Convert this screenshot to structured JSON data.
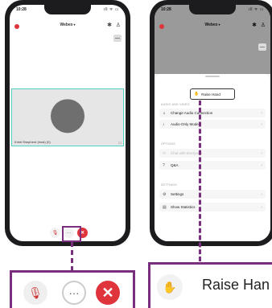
{
  "status": {
    "time": "10:28",
    "signal": "ıll ᯤ ▭"
  },
  "header": {
    "title": "Webex",
    "chevron": "▾"
  },
  "tile": {
    "participant_name": "Kristi Shepherd (host) (0)",
    "corner": "☐"
  },
  "controls": {
    "mic_glyph": "🎙",
    "more_glyph": "···",
    "end_glyph": "✕"
  },
  "sheet": {
    "raise_hand": "Raise Hand",
    "sections": [
      {
        "title": "AUDIO AND VIDEO"
      },
      {
        "title": "OPTIONS"
      },
      {
        "title": "SETTINGS"
      }
    ],
    "items": [
      {
        "label": "Change Audio Connection",
        "icon": "♫"
      },
      {
        "label": "Audio-Only Mode",
        "icon": "♪"
      },
      {
        "label": "Chat with Everyone",
        "icon": "✉"
      },
      {
        "label": "Q&A",
        "icon": "?"
      },
      {
        "label": "Settings",
        "icon": "⚙"
      },
      {
        "label": "Show Statistics",
        "icon": "▤"
      }
    ],
    "chevron": "›"
  },
  "callout": {
    "raise_hand_label": "Raise Han"
  },
  "colors": {
    "accent": "#7a2f7e",
    "end_call": "#e0343d",
    "tile_border": "#4fd1c5"
  }
}
